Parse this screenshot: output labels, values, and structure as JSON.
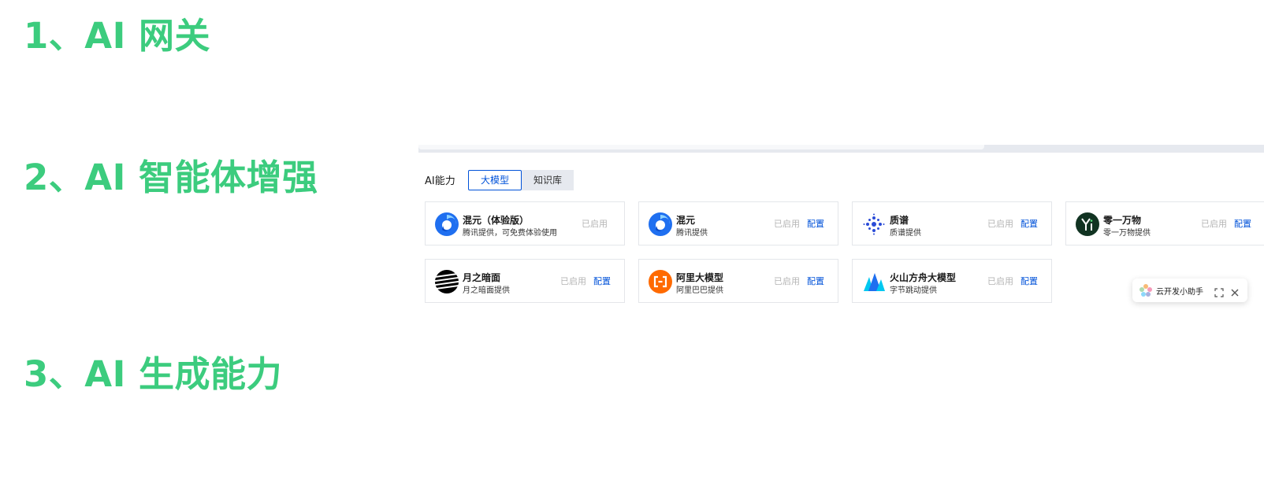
{
  "headings": {
    "h1": "1、AI 网关",
    "h2": "2、AI 智能体增强",
    "h3": "3、AI 生成能力"
  },
  "colors": {
    "heading": "#3ccc7e",
    "accent": "#0052d9",
    "muted": "#b5b5b5"
  },
  "panel": {
    "label": "AI能力",
    "tabs": [
      {
        "label": "大模型",
        "active": true
      },
      {
        "label": "知识库",
        "active": false
      }
    ]
  },
  "models": [
    {
      "name": "混元（体验版）",
      "desc": "腾讯提供，可免费体验使用",
      "status": "已启用",
      "config": "",
      "icon": "hunyuan-icon"
    },
    {
      "name": "混元",
      "desc": "腾讯提供",
      "status": "已启用",
      "config": "配置",
      "icon": "hunyuan-icon"
    },
    {
      "name": "质谱",
      "desc": "质谱提供",
      "status": "已启用",
      "config": "配置",
      "icon": "zhipu-icon"
    },
    {
      "name": "零一万物",
      "desc": "零一万物提供",
      "status": "已启用",
      "config": "配置",
      "icon": "lingyi-icon"
    },
    {
      "name": "月之暗面",
      "desc": "月之暗面提供",
      "status": "已启用",
      "config": "配置",
      "icon": "moonshot-icon"
    },
    {
      "name": "阿里大模型",
      "desc": "阿里巴巴提供",
      "status": "已启用",
      "config": "配置",
      "icon": "aliyun-icon"
    },
    {
      "name": "火山方舟大模型",
      "desc": "字节跳动提供",
      "status": "已启用",
      "config": "配置",
      "icon": "volcano-icon"
    }
  ],
  "assistant": {
    "label": "云开发小助手",
    "expand_icon": "expand-icon",
    "close_icon": "close-icon"
  }
}
